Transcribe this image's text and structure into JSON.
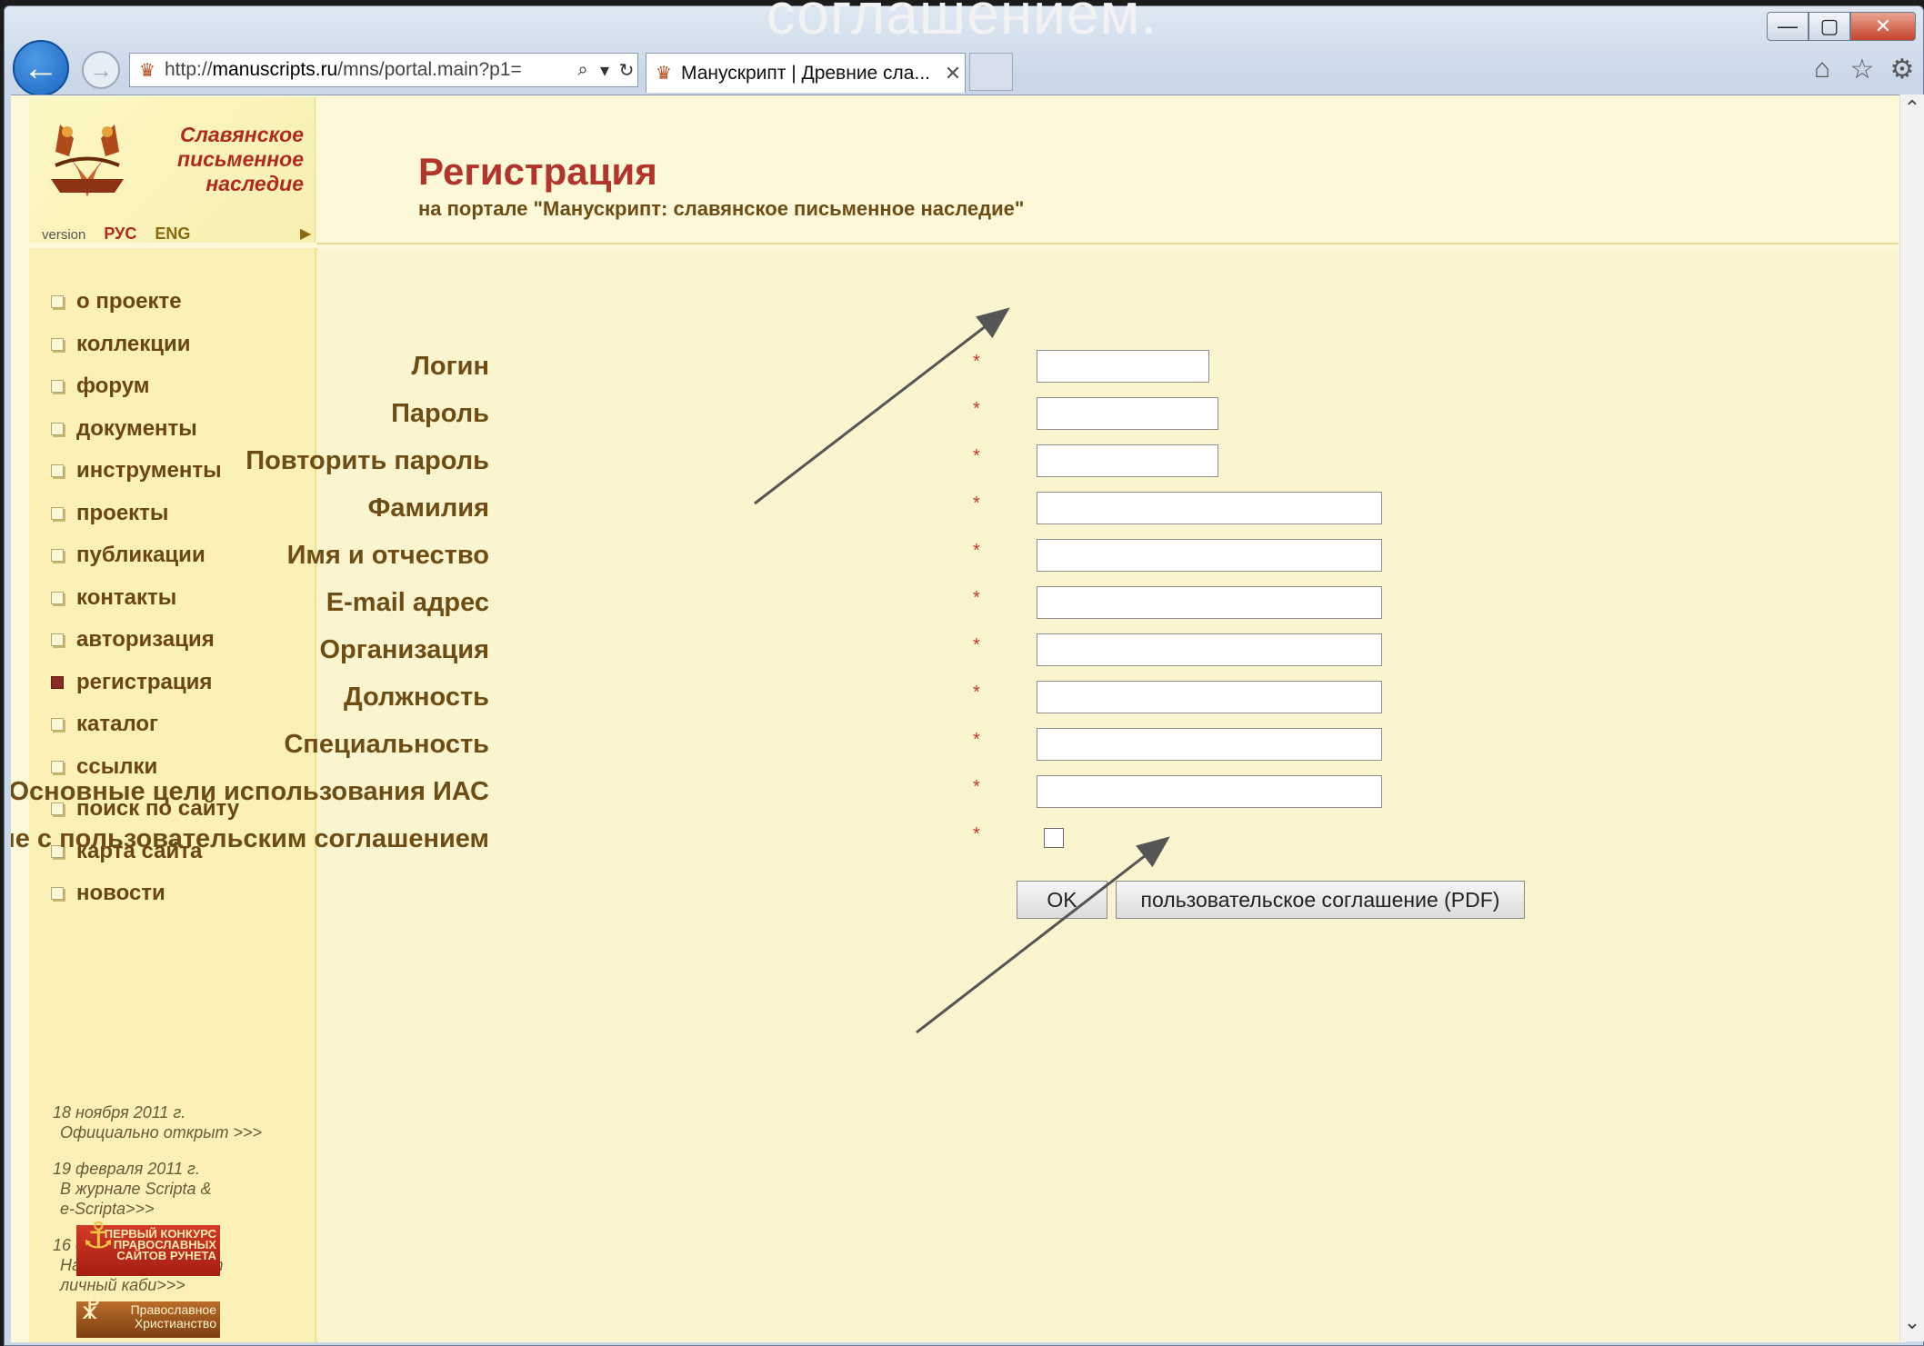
{
  "slide": {
    "caption": "соглашением."
  },
  "browser": {
    "window_controls": {
      "minimize": "—",
      "maximize": "▢",
      "close": "✕"
    },
    "address": {
      "prefix": "http://",
      "host": "manuscripts.ru",
      "path": "/mns/portal.main?p1="
    },
    "tab": {
      "title": "Манускрипт | Древние сла...",
      "close": "✕"
    }
  },
  "header": {
    "brand": [
      "Славянское",
      "письменное",
      "наследие"
    ],
    "version_label": "version",
    "lang_ru": "РУС",
    "lang_en": "ENG",
    "title": "Регистрация",
    "subtitle": "на портале \"Манускрипт: славянское письменное наследие\""
  },
  "sidebar": {
    "menu": [
      {
        "label": "о проекте",
        "active": false
      },
      {
        "label": "коллекции",
        "active": false
      },
      {
        "label": "форум",
        "active": false
      },
      {
        "label": "документы",
        "active": false
      },
      {
        "label": "инструменты",
        "active": false
      },
      {
        "label": "проекты",
        "active": false
      },
      {
        "label": "публикации",
        "active": false
      },
      {
        "label": "контакты",
        "active": false
      },
      {
        "label": "авторизация",
        "active": false
      },
      {
        "label": "регистрация",
        "active": true
      },
      {
        "label": "каталог",
        "active": false
      },
      {
        "label": "ссылки",
        "active": false
      },
      {
        "label": "поиск по сайту",
        "active": false
      },
      {
        "label": "карта сайта",
        "active": false
      },
      {
        "label": "новости",
        "active": false
      }
    ],
    "news": [
      {
        "date": "18 ноября 2011 г.",
        "text": "Официально открыт >>>"
      },
      {
        "date": "19 февраля 2011 г.",
        "text": "В журнале Scripta &\ne-Scripta>>>"
      },
      {
        "date": "16 декабря 2010 г.",
        "text": "На портале открыт\nличный каби>>>"
      }
    ],
    "badge1": "ПЕРВЫЙ КОНКУРС ПРАВОСЛАВНЫХ САЙТОВ РУНЕТА",
    "badge2": "Православное Христианство"
  },
  "form": {
    "required_mark": "*",
    "fields": [
      {
        "label": "Логин",
        "value": ""
      },
      {
        "label": "Пароль",
        "value": ""
      },
      {
        "label": "Повторить пароль",
        "value": ""
      },
      {
        "label": "Фамилия",
        "value": ""
      },
      {
        "label": "Имя и отчество",
        "value": ""
      },
      {
        "label": "E-mail адрес",
        "value": ""
      },
      {
        "label": "Организация",
        "value": ""
      },
      {
        "label": "Должность",
        "value": ""
      },
      {
        "label": "Специальность",
        "value": ""
      },
      {
        "label": "Основные цели использования ИАС",
        "value": ""
      }
    ],
    "agreement_label": "Согласие с пользовательским соглашением",
    "agreement_checked": false,
    "ok_label": "OK",
    "pdf_label": "пользовательское соглашение (PDF)"
  }
}
